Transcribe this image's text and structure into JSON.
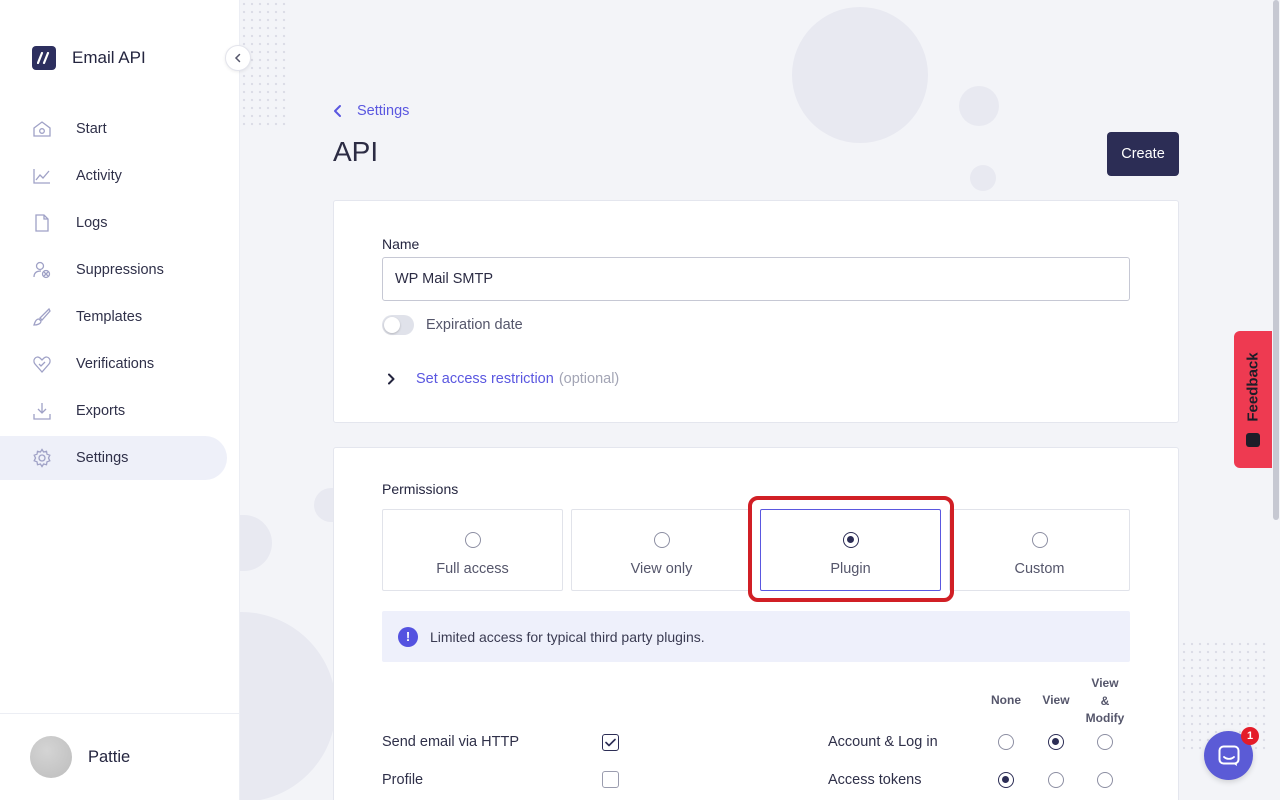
{
  "brand": {
    "name": "Email API",
    "icon": "slash-logo-icon"
  },
  "nav": {
    "items": [
      {
        "label": "Start",
        "icon": "home-icon"
      },
      {
        "label": "Activity",
        "icon": "activity-chart-icon"
      },
      {
        "label": "Logs",
        "icon": "file-icon"
      },
      {
        "label": "Suppressions",
        "icon": "user-block-icon"
      },
      {
        "label": "Templates",
        "icon": "brush-icon"
      },
      {
        "label": "Verifications",
        "icon": "heart-check-icon"
      },
      {
        "label": "Exports",
        "icon": "download-icon"
      },
      {
        "label": "Settings",
        "icon": "gear-icon",
        "active": true
      }
    ]
  },
  "user": {
    "name": "Pattie"
  },
  "header": {
    "breadcrumb": "Settings",
    "title": "API",
    "create_label": "Create"
  },
  "form": {
    "name_label": "Name",
    "name_value": "WP Mail SMTP",
    "expiration_label": "Expiration date",
    "expiration_enabled": false,
    "restriction_link": "Set access restriction",
    "restriction_optional": "(optional)"
  },
  "permissions": {
    "label": "Permissions",
    "options": [
      {
        "label": "Full access",
        "selected": false
      },
      {
        "label": "View only",
        "selected": false
      },
      {
        "label": "Plugin",
        "selected": true
      },
      {
        "label": "Custom",
        "selected": false
      }
    ],
    "info": "Limited access for typical third party plugins.",
    "columns": {
      "none": "None",
      "view": "View",
      "modify_1": "View",
      "modify_2": "&",
      "modify_3": "Modify"
    },
    "left_rows": [
      {
        "label": "Send email via HTTP",
        "checked": true
      },
      {
        "label": "Profile",
        "checked": false
      }
    ],
    "right_rows": [
      {
        "label": "Account & Log in",
        "value": "view"
      },
      {
        "label": "Access tokens",
        "value": "none"
      }
    ]
  },
  "feedback": {
    "label": "Feedback"
  },
  "chat": {
    "badge": "1"
  },
  "colors": {
    "accent": "#5a57e0",
    "primary": "#2c2d55",
    "highlight": "#d11f25",
    "feedback": "#ee3a51"
  }
}
